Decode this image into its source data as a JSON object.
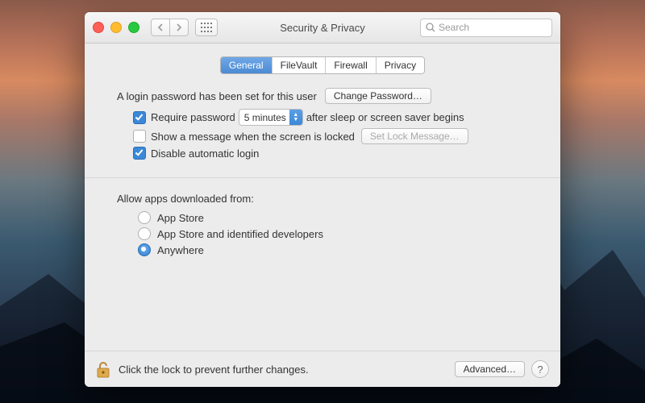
{
  "window": {
    "title": "Security & Privacy"
  },
  "search": {
    "placeholder": "Search"
  },
  "tabs": {
    "general": "General",
    "filevault": "FileVault",
    "firewall": "Firewall",
    "privacy": "Privacy"
  },
  "login": {
    "set_msg": "A login password has been set for this user",
    "change_btn": "Change Password…",
    "require_label": "Require password",
    "require_value": "5 minutes",
    "require_after": "after sleep or screen saver begins",
    "show_message": "Show a message when the screen is locked",
    "set_lock_btn": "Set Lock Message…",
    "disable_auto": "Disable automatic login"
  },
  "allow": {
    "title": "Allow apps downloaded from:",
    "appstore": "App Store",
    "identified": "App Store and identified developers",
    "anywhere": "Anywhere"
  },
  "footer": {
    "lock_msg": "Click the lock to prevent further changes.",
    "advanced": "Advanced…"
  }
}
